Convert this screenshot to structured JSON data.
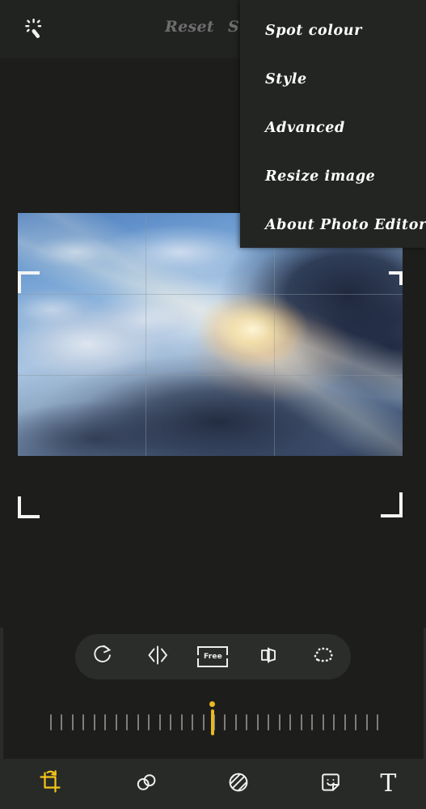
{
  "app": {
    "name": "Photo Editor",
    "background_color": "#1d1e1c",
    "accent_color": "#e8b921"
  },
  "topbar": {
    "wand_icon": "magic-wand-sparkle-icon",
    "reset_label": "Reset",
    "save_label": "S",
    "save_label_full": "Save",
    "inactive_color": "#6e6e6e"
  },
  "menu": {
    "open": true,
    "background_color": "#232523",
    "text_color": "#ffffff",
    "items": [
      {
        "label": "Spot colour"
      },
      {
        "label": "Style"
      },
      {
        "label": "Advanced"
      },
      {
        "label": "Resize image"
      },
      {
        "label": "About Photo Editor"
      }
    ]
  },
  "canvas": {
    "photo_description": "Dramatic sky photo: sun rays breaking through dark storm clouds over blue sky",
    "crop_overlay": "rule-of-thirds-grid",
    "handles": [
      "top-left",
      "top-right",
      "bottom-left",
      "bottom-right"
    ]
  },
  "crop_tools": [
    {
      "name": "rotate",
      "icon": "rotate-icon",
      "label": ""
    },
    {
      "name": "flip",
      "icon": "flip-horizontal-icon",
      "label": ""
    },
    {
      "name": "aspect-ratio",
      "icon": "crop-frame-icon",
      "label": "Free"
    },
    {
      "name": "perspective",
      "icon": "perspective-icon",
      "label": ""
    },
    {
      "name": "freeform",
      "icon": "lasso-dotted-icon",
      "label": ""
    }
  ],
  "ruler": {
    "value": 0,
    "unit": "degrees",
    "tick_count": 31,
    "indicator_color": "#e8b921",
    "tick_color": "#7e7e7e"
  },
  "bottom_nav": {
    "background_color": "#282a28",
    "active_color": "#f5c518",
    "items": [
      {
        "name": "crop",
        "icon": "crop-rotate-icon",
        "active": true,
        "label": ""
      },
      {
        "name": "adjust",
        "icon": "color-circles-icon",
        "active": false,
        "label": ""
      },
      {
        "name": "filters",
        "icon": "hatched-circle-icon",
        "active": false,
        "label": ""
      },
      {
        "name": "stickers",
        "icon": "sticker-smiley-icon",
        "active": false,
        "label": ""
      },
      {
        "name": "text",
        "icon": "text-t-icon",
        "active": false,
        "label": "T"
      }
    ]
  }
}
